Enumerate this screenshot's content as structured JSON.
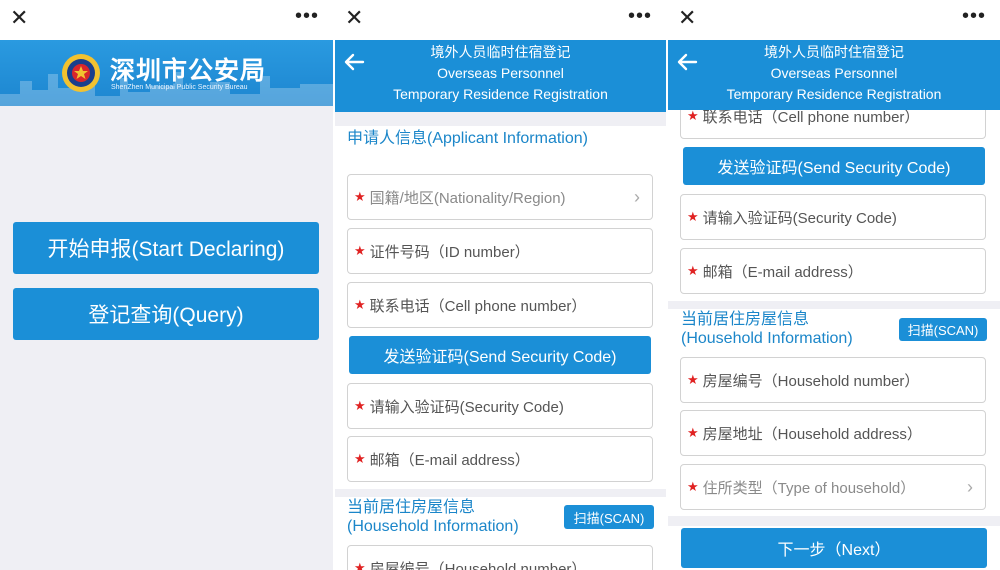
{
  "panel1": {
    "banner_title": "深圳市公安局",
    "banner_subtitle": "ShenZhen Municipal Public Security Bureau",
    "start_btn": "开始申报(Start Declaring)",
    "query_btn": "登记查询(Query)"
  },
  "header": {
    "line1": "境外人员临时住宿登记",
    "line2": "Overseas Personnel",
    "line3": "Temporary Residence Registration"
  },
  "applicant": {
    "title": "申请人信息(Applicant Information)",
    "nationality": "国籍/地区(Nationality/Region)",
    "id_number": "证件号码（ID number）",
    "phone": "联系电话（Cell phone number）",
    "send_code": "发送验证码(Send Security Code)",
    "security_code": "请输入验证码(Security Code)",
    "email": "邮箱（E-mail address）"
  },
  "household": {
    "title1": "当前居住房屋信息",
    "title2": "(Household Information)",
    "scan": "扫描(SCAN)",
    "number": "房屋编号（Household number）",
    "address": "房屋地址（Household address）",
    "type": "住所类型（Type of household）"
  },
  "next_btn": "下一步（Next）",
  "colors": {
    "primary": "#1b8fd7",
    "required": "#e02222",
    "section": "#1b86c9"
  },
  "icons": [
    "close-icon",
    "more-icon",
    "back-arrow-icon",
    "chevron-right-icon",
    "police-emblem-icon"
  ]
}
